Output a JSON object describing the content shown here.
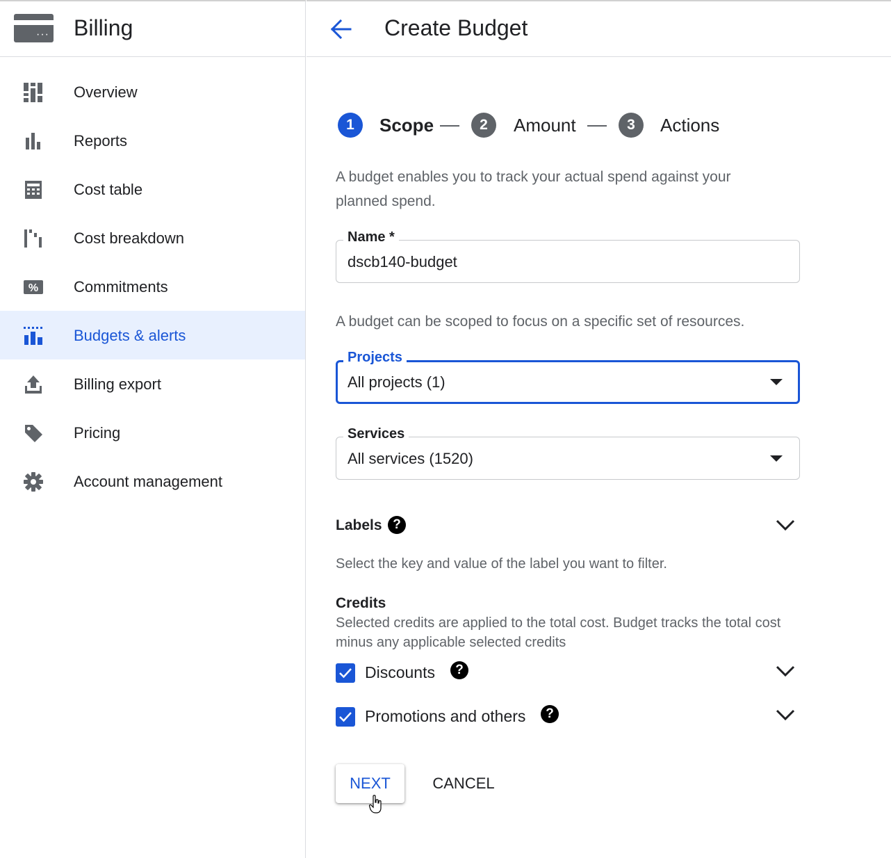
{
  "app": {
    "title": "Billing"
  },
  "sidebar": {
    "items": [
      {
        "label": "Overview",
        "icon": "dashboard-icon",
        "active": false
      },
      {
        "label": "Reports",
        "icon": "bar-chart-icon",
        "active": false
      },
      {
        "label": "Cost table",
        "icon": "table-icon",
        "active": false
      },
      {
        "label": "Cost breakdown",
        "icon": "waterfall-chart-icon",
        "active": false
      },
      {
        "label": "Commitments",
        "icon": "percent-ticket-icon",
        "active": false
      },
      {
        "label": "Budgets & alerts",
        "icon": "budget-chart-icon",
        "active": true
      },
      {
        "label": "Billing export",
        "icon": "upload-icon",
        "active": false
      },
      {
        "label": "Pricing",
        "icon": "tag-icon",
        "active": false
      },
      {
        "label": "Account management",
        "icon": "gear-icon",
        "active": false
      }
    ]
  },
  "header": {
    "title": "Create Budget",
    "back_icon": "arrow-back-icon"
  },
  "stepper": {
    "steps": [
      {
        "number": "1",
        "label": "Scope",
        "state": "active"
      },
      {
        "number": "2",
        "label": "Amount",
        "state": "inactive"
      },
      {
        "number": "3",
        "label": "Actions",
        "state": "inactive"
      }
    ]
  },
  "form": {
    "intro": "A budget enables you to track your actual spend against your planned spend.",
    "name_field": {
      "label": "Name *",
      "value": "dscb140-budget"
    },
    "scope_text": "A budget can be scoped to focus on a specific set of resources.",
    "projects_field": {
      "label": "Projects",
      "value": "All projects (1)"
    },
    "services_field": {
      "label": "Services",
      "value": "All services (1520)"
    },
    "labels": {
      "heading": "Labels",
      "description": "Select the key and value of the label you want to filter."
    },
    "credits": {
      "heading": "Credits",
      "description": "Selected credits are applied to the total cost. Budget tracks the total cost minus any applicable selected credits",
      "options": [
        {
          "label": "Discounts",
          "checked": true
        },
        {
          "label": "Promotions and others",
          "checked": true
        }
      ]
    }
  },
  "buttons": {
    "next": "NEXT",
    "cancel": "CANCEL"
  },
  "colors": {
    "accent": "#1a56d6",
    "active_bg": "#e8f0fe",
    "step_inactive": "#5f6368"
  }
}
